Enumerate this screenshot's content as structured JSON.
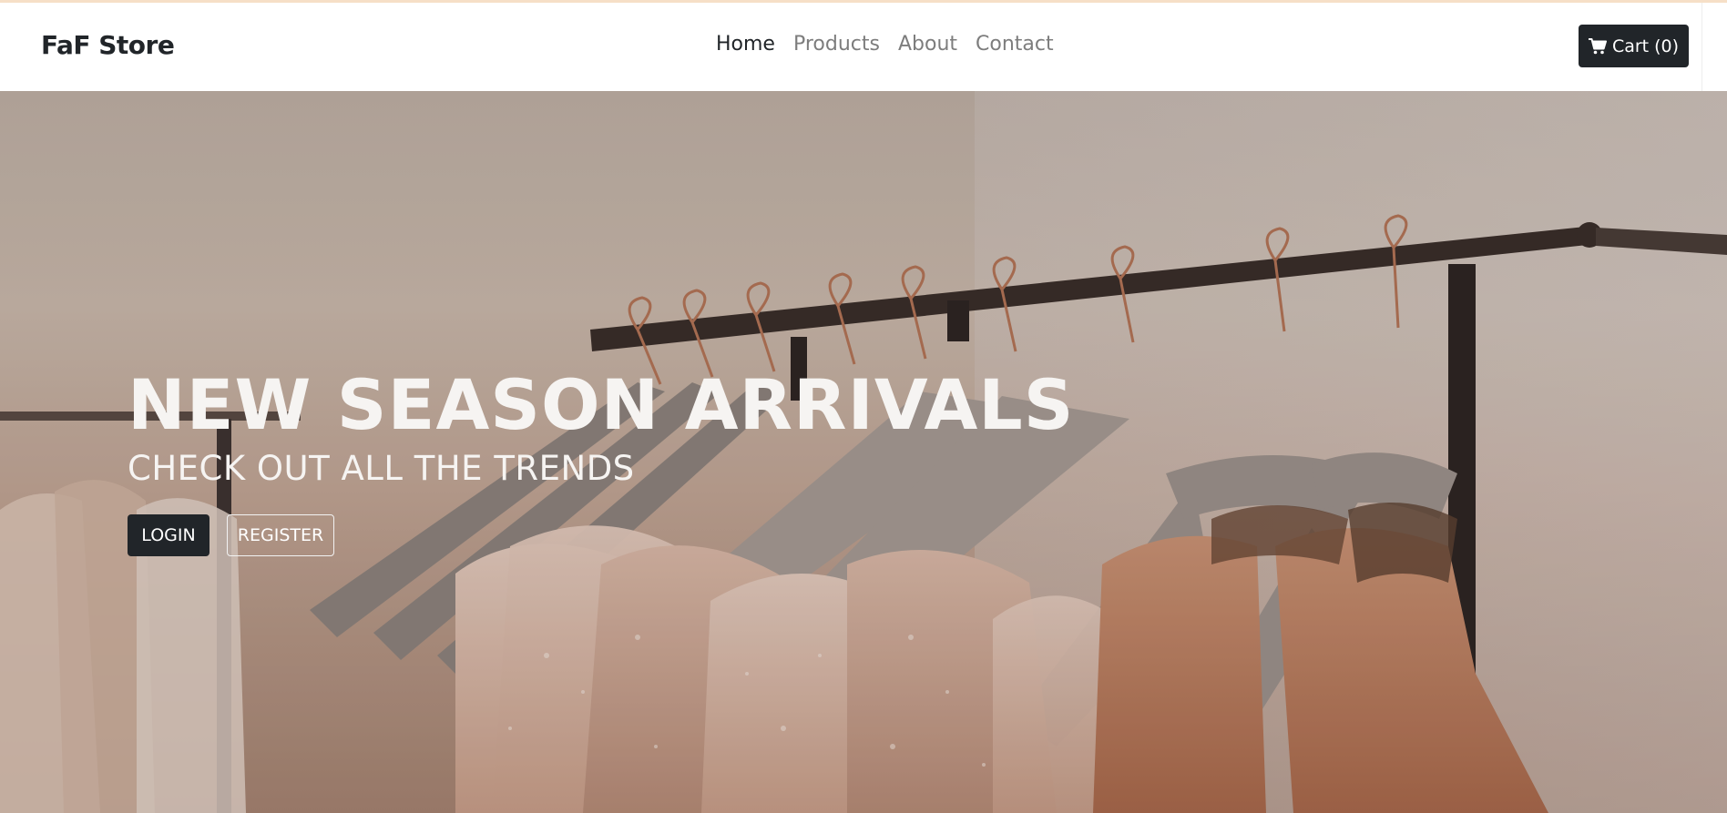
{
  "brand": {
    "name": "FaF Store"
  },
  "nav": {
    "links": [
      {
        "label": "Home",
        "active": true
      },
      {
        "label": "Products",
        "active": false
      },
      {
        "label": "About",
        "active": false
      },
      {
        "label": "Contact",
        "active": false
      }
    ]
  },
  "cart": {
    "label": "Cart (0)",
    "icon": "shopping-cart-icon"
  },
  "hero": {
    "title": "NEW SEASON ARRIVALS",
    "subtitle": "CHECK OUT ALL THE TRENDS",
    "login_label": "LOGIN",
    "register_label": "REGISTER",
    "image": "clothing-rack-photo"
  },
  "colors": {
    "dark": "#212529",
    "muted_link": "#7d7d7d",
    "hero_text": "#f6f4f2"
  }
}
